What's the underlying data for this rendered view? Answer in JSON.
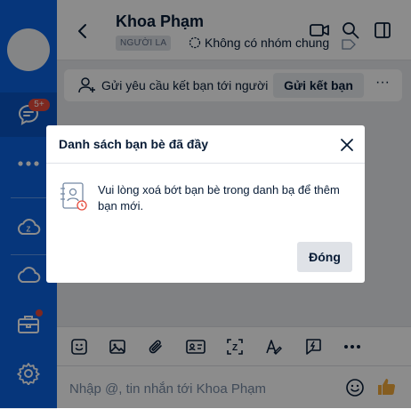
{
  "sidebar": {
    "chat_badge": "5+",
    "items": [
      {
        "icon": "avatar"
      },
      {
        "icon": "chat-icon"
      },
      {
        "icon": "more-dots-icon"
      },
      {
        "icon": "zcloud-icon"
      },
      {
        "icon": "cloud-icon"
      },
      {
        "icon": "toolbox-icon"
      },
      {
        "icon": "gear-icon"
      }
    ]
  },
  "header": {
    "contact_name": "Khoa Phạm",
    "stranger_badge": "NGƯỜI LA",
    "mutual_groups": "Không có nhóm chung"
  },
  "friend_request": {
    "text": "Gửi yêu cầu kết bạn tới người",
    "button": "Gửi kết bạn",
    "more": "···"
  },
  "composer": {
    "placeholder": "Nhập @, tin nhắn tới Khoa Phạm"
  },
  "dialog": {
    "title": "Danh sách bạn bè đã đầy",
    "message": "Vui lòng xoá bớt bạn bè trong danh bạ để thêm bạn mới.",
    "close_button": "Đóng"
  },
  "colors": {
    "sidebar": "#0b63e0",
    "badge": "#e64a3b",
    "like": "#f2a93b"
  }
}
